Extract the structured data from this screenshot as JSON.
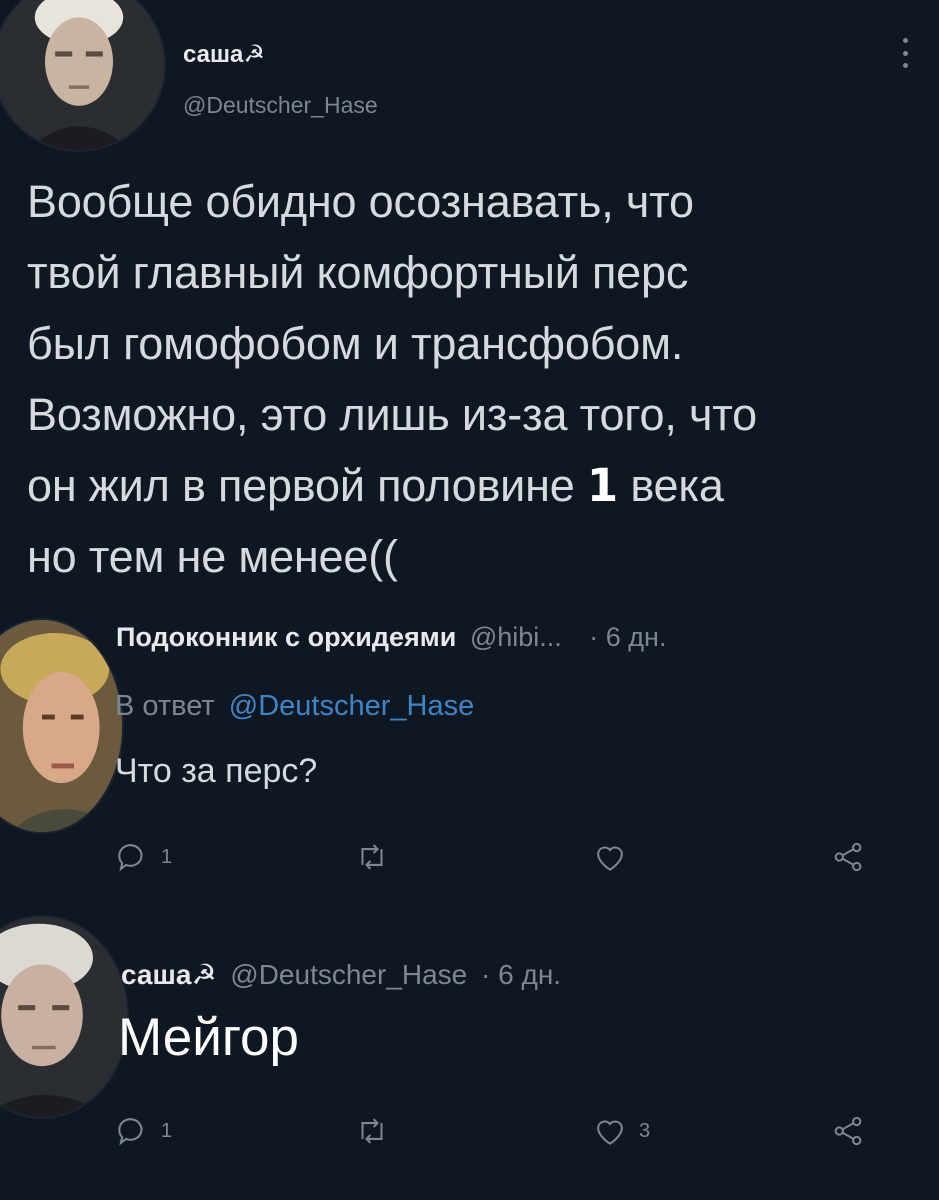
{
  "main_tweet": {
    "display_name": "саша☭",
    "handle": "@Deutscher_Hase",
    "text_lines": [
      "Вообще обидно осознавать, что",
      "твой главный комфортный перс",
      "был гомофобом и трансфобом.",
      "Возможно, это лишь из-за того, что"
    ],
    "line5_before": "он жил в первой половине ",
    "line5_bold": "1",
    "line5_after": " века",
    "line6": "но тем не менее(("
  },
  "reply_1": {
    "display_name": "Подоконник с орхидеями",
    "handle": "@hibi...",
    "time": "· 6 дн.",
    "reply_prefix": "В ответ",
    "reply_to": "@Deutscher_Hase",
    "text": "Что за перс?",
    "reply_count": "1"
  },
  "reply_2": {
    "display_name": "саша☭",
    "handle": "@Deutscher_Hase",
    "time": "· 6 дн.",
    "text": "Мейгор",
    "reply_count": "1",
    "like_count": "3"
  },
  "icons": {
    "reply": "reply-icon",
    "retweet": "retweet-icon",
    "like": "heart-icon",
    "share": "share-icon",
    "more": "more-vertical-icon"
  },
  "colors": {
    "background": "#0f1722",
    "link": "#3c86c8",
    "muted": "#7b8794"
  }
}
